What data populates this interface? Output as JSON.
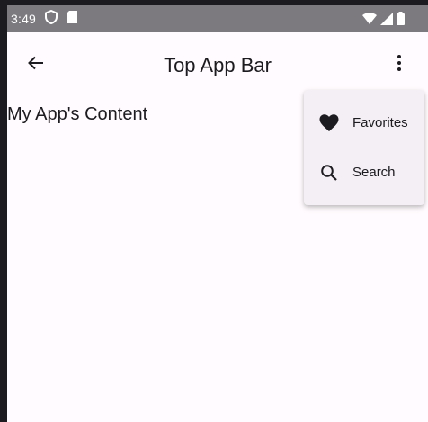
{
  "status_bar": {
    "time": "3:49",
    "icons_left": [
      "shield-icon",
      "sd-card-icon"
    ],
    "icons_right": [
      "wifi-icon",
      "signal-icon",
      "battery-icon"
    ]
  },
  "app_bar": {
    "title": "Top App Bar",
    "navigation_icon": "arrow-back-icon",
    "action_icon": "more-vert-icon"
  },
  "content": {
    "text": "My App's Content"
  },
  "overflow_menu": {
    "items": [
      {
        "label": "Favorites",
        "icon": "heart-icon"
      },
      {
        "label": "Search",
        "icon": "search-icon"
      }
    ]
  },
  "colors": {
    "status_bar": "#7d7a7f",
    "surface": "#fffbfe",
    "menu_surface": "#f4eff4",
    "on_surface": "#1c1b1f"
  }
}
